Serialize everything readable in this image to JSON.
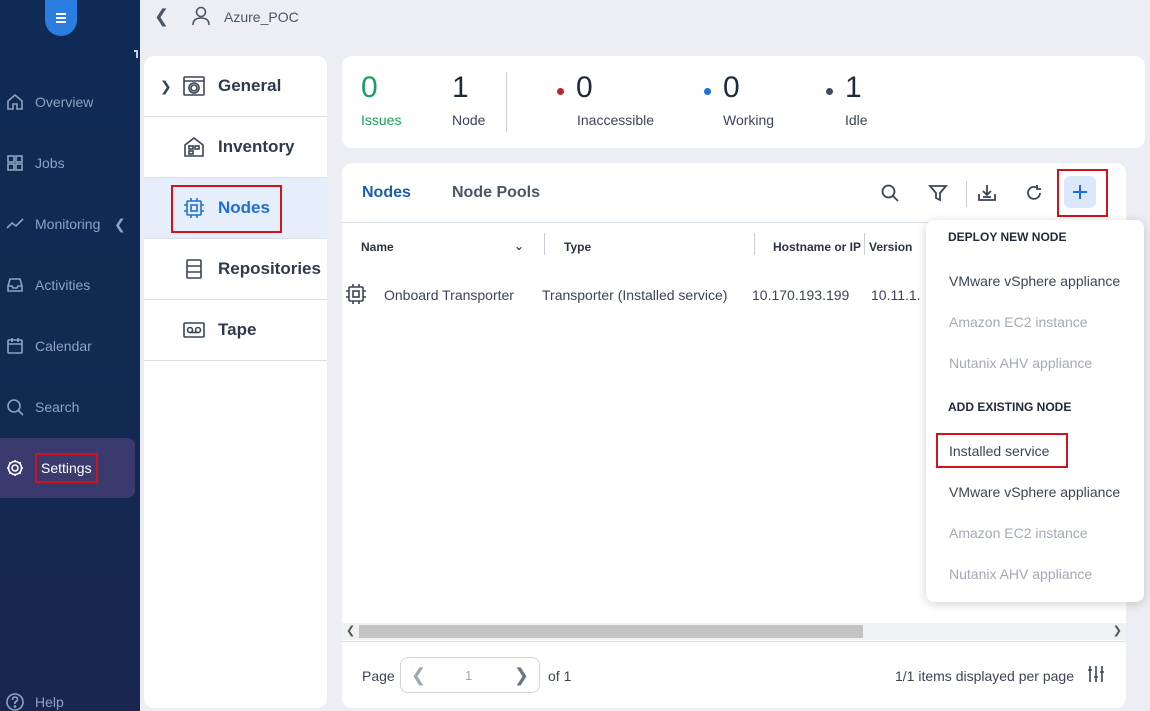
{
  "header": {
    "breadcrumb": "Azure_POC"
  },
  "nav": {
    "items": [
      {
        "label": "Overview",
        "icon": "home-icon"
      },
      {
        "label": "Jobs",
        "icon": "grid-icon"
      },
      {
        "label": "Monitoring",
        "icon": "trend-icon"
      },
      {
        "label": "Activities",
        "icon": "inbox-icon"
      },
      {
        "label": "Calendar",
        "icon": "calendar-icon"
      },
      {
        "label": "Search",
        "icon": "search-icon"
      },
      {
        "label": "Settings",
        "icon": "gear-icon"
      },
      {
        "label": "Help",
        "icon": "help-icon"
      }
    ]
  },
  "subnav": {
    "items": [
      {
        "label": "General"
      },
      {
        "label": "Inventory"
      },
      {
        "label": "Nodes"
      },
      {
        "label": "Repositories"
      },
      {
        "label": "Tape"
      }
    ]
  },
  "stats": {
    "issues": {
      "value": "0",
      "label": "Issues"
    },
    "node": {
      "value": "1",
      "label": "Node"
    },
    "inaccessible": {
      "value": "0",
      "label": "Inaccessible"
    },
    "working": {
      "value": "0",
      "label": "Working"
    },
    "idle": {
      "value": "1",
      "label": "Idle"
    }
  },
  "colors": {
    "issues": "#1aa05a",
    "inaccessible_dot": "#c0242c",
    "working_dot": "#1d6fd8",
    "idle_dot": "#3d4a66",
    "accent": "#1d6fd8"
  },
  "tabs": [
    {
      "label": "Nodes"
    },
    {
      "label": "Node Pools"
    }
  ],
  "table": {
    "columns": [
      "Name",
      "Type",
      "Hostname or IP",
      "Version"
    ],
    "rows": [
      {
        "name": "Onboard Transporter",
        "type": "Transporter (Installed service)",
        "hostname": "10.170.193.199",
        "version": "10.11.1."
      }
    ]
  },
  "pagination": {
    "page_label": "Page",
    "page": "1",
    "of_label": "of 1",
    "per_page": "1/1 items displayed per page"
  },
  "dropdown": {
    "deploy_header": "DEPLOY NEW NODE",
    "deploy_items": [
      "VMware vSphere appliance",
      "Amazon EC2 instance",
      "Nutanix AHV appliance"
    ],
    "existing_header": "ADD EXISTING NODE",
    "existing_items": [
      "Installed service",
      "VMware vSphere appliance",
      "Amazon EC2 instance",
      "Nutanix AHV appliance"
    ]
  }
}
